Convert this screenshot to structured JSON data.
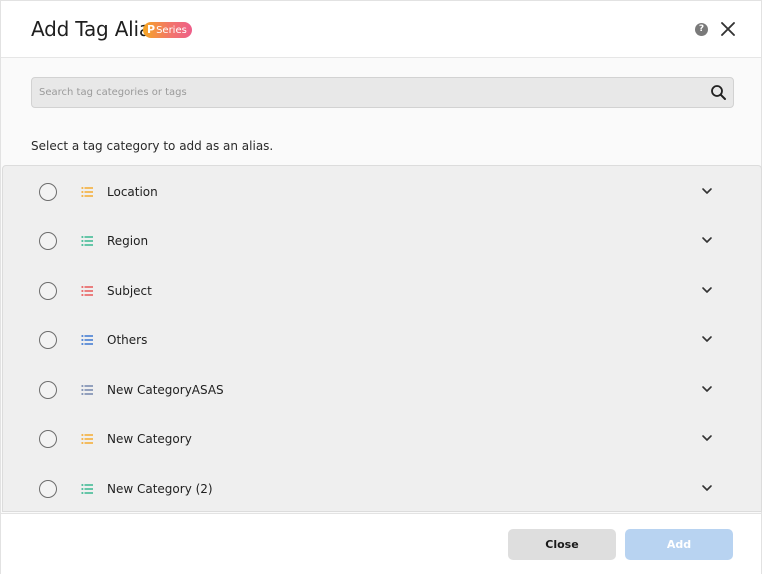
{
  "dialog": {
    "title": "Add Tag Alias",
    "badge_prefix": "P",
    "badge_text": "Series",
    "help_glyph": "?"
  },
  "search": {
    "placeholder": "Search tag categories or tags",
    "value": ""
  },
  "instruction": "Select a tag category to add as an alias.",
  "categories": [
    {
      "label": "Location",
      "color": "#f5a623"
    },
    {
      "label": "Region",
      "color": "#2bb58a"
    },
    {
      "label": "Subject",
      "color": "#e94e4e"
    },
    {
      "label": "Others",
      "color": "#2f6fd0"
    },
    {
      "label": "New CategoryASAS",
      "color": "#6b7fa8"
    },
    {
      "label": "New Category",
      "color": "#f5a623"
    },
    {
      "label": "New Category (2)",
      "color": "#2bb58a"
    }
  ],
  "footer": {
    "close_label": "Close",
    "add_label": "Add"
  },
  "colors": {
    "add_disabled": "#b8d3f1",
    "close_bg": "#dedede"
  }
}
